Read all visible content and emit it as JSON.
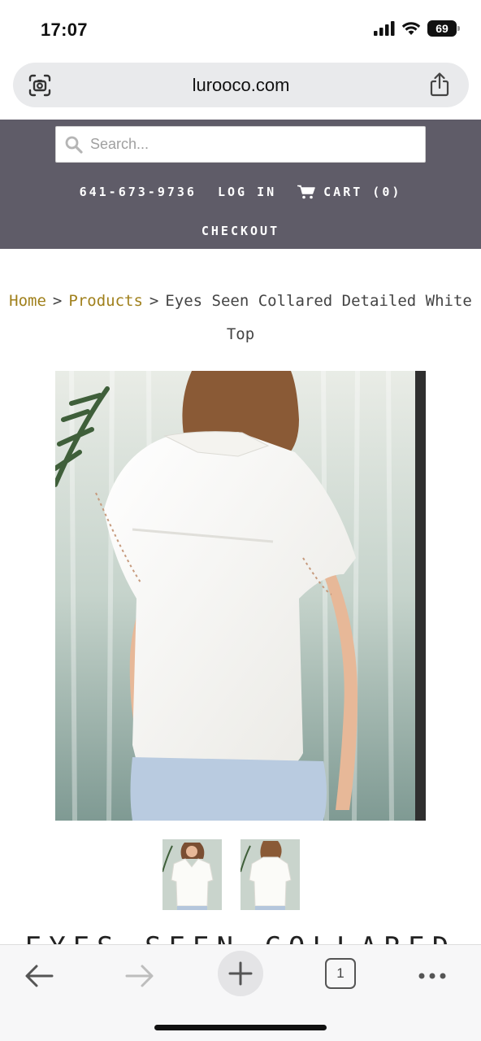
{
  "status_bar": {
    "time": "17:07",
    "battery": "69"
  },
  "browser": {
    "url": "lurooco.com"
  },
  "site_header": {
    "search_placeholder": "Search...",
    "phone": "641-673-9736",
    "login_label": "LOG IN",
    "cart_label": "CART (0)",
    "checkout_label": "CHECKOUT"
  },
  "breadcrumb": {
    "home": "Home",
    "separator": ">",
    "products": "Products",
    "current": "Eyes Seen Collared Detailed White Top"
  },
  "product": {
    "title": "EYES SEEN COLLARED",
    "thumbnail_count": 2
  },
  "toolbar": {
    "tab_count": "1"
  },
  "colors": {
    "header_bg": "#5f5c68",
    "breadcrumb_link": "#a0801c",
    "address_bar_bg": "#e9eaec"
  }
}
